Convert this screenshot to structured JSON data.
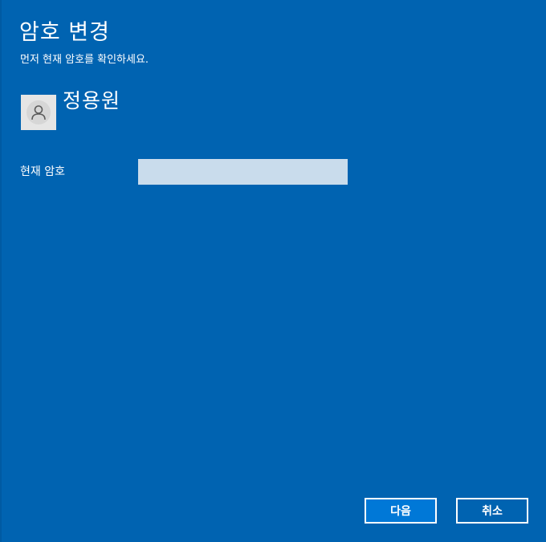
{
  "dialog": {
    "title": "암호 변경",
    "subtitle": "먼저 현재 암호를 확인하세요."
  },
  "user": {
    "name": "정용원",
    "avatar_icon": "person-icon"
  },
  "form": {
    "current_password_label": "현재 암호",
    "current_password_value": "",
    "current_password_placeholder": ""
  },
  "buttons": {
    "next_label": "다음",
    "cancel_label": "취소"
  },
  "colors": {
    "background": "#0063b1",
    "primary_button": "#0078d7",
    "input_background": "#c9dcec",
    "text": "#ffffff"
  }
}
